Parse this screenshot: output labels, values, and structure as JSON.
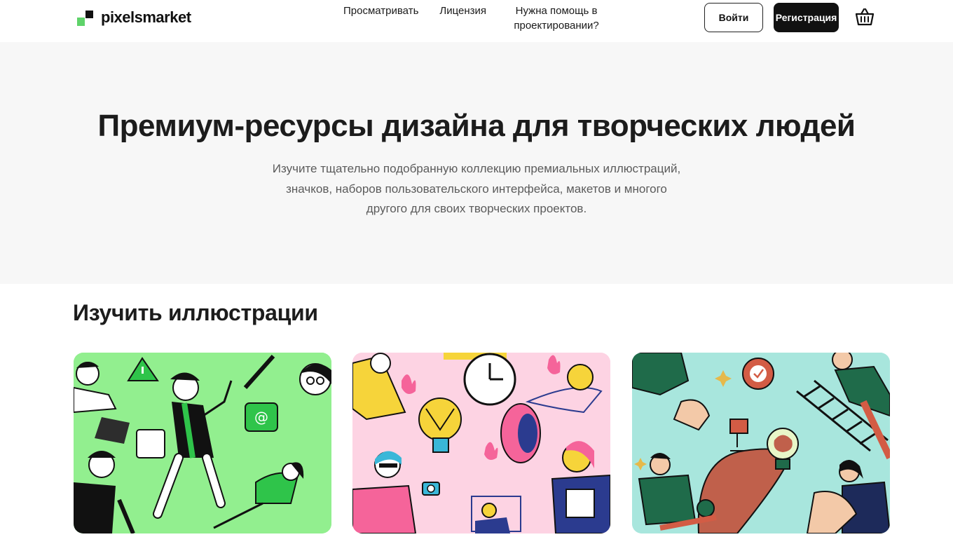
{
  "brand": {
    "name": "pixelsmarket"
  },
  "nav": {
    "items": [
      {
        "label": "Просматривать"
      },
      {
        "label": "Лицензия"
      },
      {
        "label": "Нужна помощь в проектировании?"
      }
    ]
  },
  "auth": {
    "login_label": "Войти",
    "signup_label": "Регистрация"
  },
  "icons": {
    "cart": "basket-icon"
  },
  "hero": {
    "title": "Премиум-ресурсы дизайна для творческих людей",
    "subtitle": "Изучите тщательно подобранную коллекцию премиальных иллюстраций, значков, наборов пользовательского интерфейса, макетов и многого другого для своих творческих проектов."
  },
  "section": {
    "title": "Изучить иллюстрации"
  },
  "colors": {
    "accent": "#5fd36a",
    "card1": "#92ef8f",
    "card2": "#fdd3e3",
    "card3": "#a8e6dd",
    "dark": "#111111",
    "hero_bg": "#f7f7f7"
  }
}
